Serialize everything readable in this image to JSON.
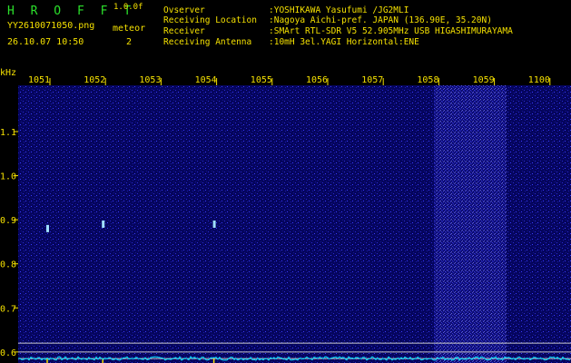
{
  "header": {
    "title": "H R O F F T",
    "version": "1.0.0f",
    "filename": "YY2610071050.png",
    "timestamp": "26.10.07 10:50",
    "meteor_label": "meteor",
    "meteor_count": "2",
    "info": [
      {
        "label": "Ovserver",
        "value": ":YOSHIKAWA Yasufumi /JG2MLI"
      },
      {
        "label": "Receiving Location",
        "value": ":Nagoya Aichi-pref. JAPAN (136.90E, 35.20N)"
      },
      {
        "label": "Receiver",
        "value": ":SMArt RTL-SDR V5 52.905MHz USB HIGASHIMURAYAMA"
      },
      {
        "label": "Receiving Antenna",
        "value": ":10mH 3el.YAGI Horizontal:ENE"
      }
    ]
  },
  "chart_data": {
    "type": "heatmap",
    "ylabel": "kHz",
    "y_ticks": [
      "1.1",
      "1.0",
      "0.9",
      "0.8",
      "0.7",
      "0.6"
    ],
    "x_ticks": [
      "1051",
      "1052",
      "1053",
      "1054",
      "1055",
      "1056",
      "1057",
      "1058",
      "1059",
      "1100"
    ],
    "ylim": [
      0.575,
      1.205
    ],
    "meteor_echoes": [
      {
        "time": "1051",
        "freq_khz": 0.88
      },
      {
        "time": "1052",
        "freq_khz": 0.89
      },
      {
        "time": "1054",
        "freq_khz": 0.89
      }
    ],
    "reference_lines_khz": [
      0.62,
      0.6,
      0.585
    ],
    "noise_band_time": [
      "1058",
      "1059"
    ],
    "colors": {
      "background": "#00005a",
      "noise": "#3c3cff",
      "trace": "#00e0ff",
      "label": "#f4e000"
    }
  }
}
